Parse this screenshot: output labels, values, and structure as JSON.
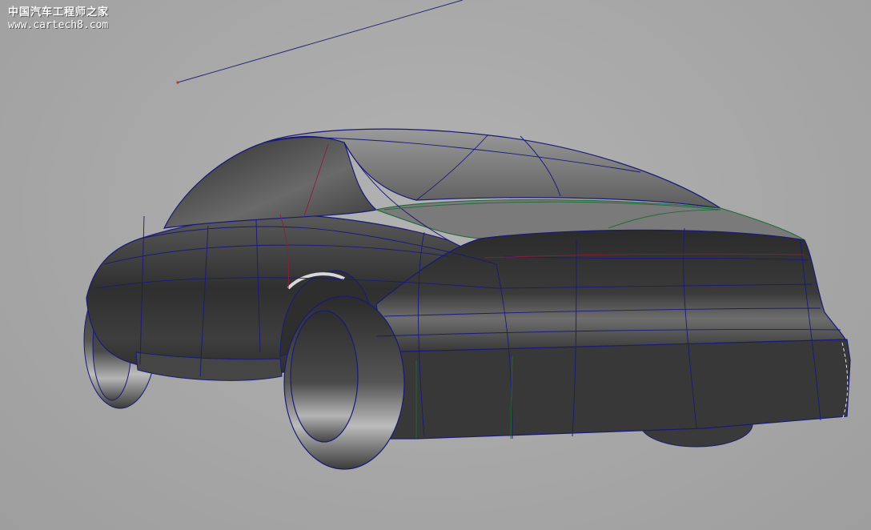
{
  "watermark": {
    "site_name": "中国汽车工程师之家",
    "url": "www.cartech8.com"
  },
  "viewport": {
    "object": "car-surface-model",
    "background_color": "#a9a9a9",
    "surface_color": "#3a3a3a",
    "isoparm_color": "#1a1a7a",
    "accent_curve_color": "#1f6b3a",
    "edge_curve_color": "#8a1f3a"
  }
}
